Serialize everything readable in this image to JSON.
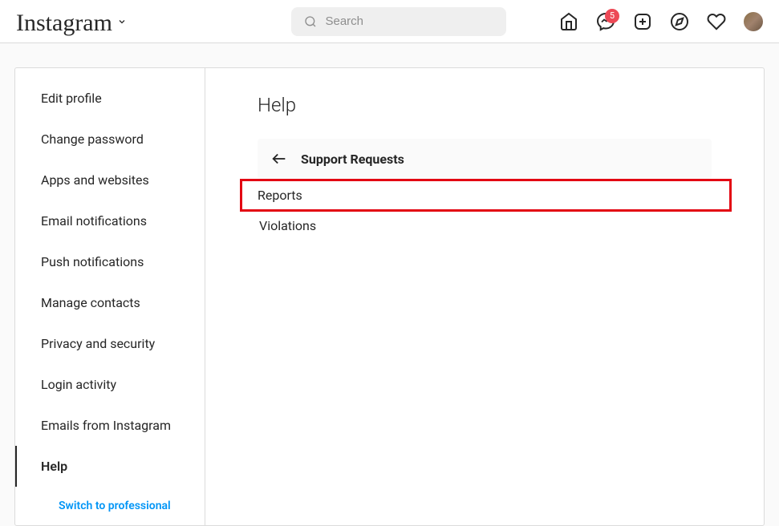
{
  "header": {
    "logo": "Instagram",
    "search_placeholder": "Search",
    "badge_count": "5"
  },
  "sidebar": {
    "items": [
      {
        "label": "Edit profile"
      },
      {
        "label": "Change password"
      },
      {
        "label": "Apps and websites"
      },
      {
        "label": "Email notifications"
      },
      {
        "label": "Push notifications"
      },
      {
        "label": "Manage contacts"
      },
      {
        "label": "Privacy and security"
      },
      {
        "label": "Login activity"
      },
      {
        "label": "Emails from Instagram"
      },
      {
        "label": "Help"
      }
    ],
    "switch_label": "Switch to professional"
  },
  "content": {
    "title": "Help",
    "section": "Support Requests",
    "options": [
      {
        "label": "Reports"
      },
      {
        "label": "Violations"
      }
    ]
  }
}
